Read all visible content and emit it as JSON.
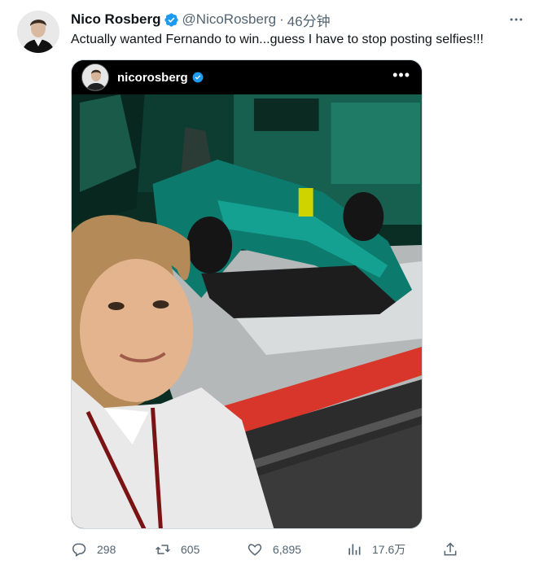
{
  "user": {
    "display_name": "Nico Rosberg",
    "handle": "@NicoRosberg",
    "separator": "·",
    "time": "46分钟"
  },
  "tweet": {
    "text": "Actually wanted Fernando to win...guess I have to stop posting selfies!!!"
  },
  "media": {
    "instagram_username": "nicorosberg",
    "more_glyph": "•••"
  },
  "actions": {
    "replies": "298",
    "retweets": "605",
    "likes": "6,895",
    "views": "17.6万"
  },
  "colors": {
    "text": "#0f1419",
    "secondary": "#536471",
    "verified": "#1d9bf0",
    "border": "#cfd9de",
    "car_teal": "#0d7a6e",
    "garage_green": "#0b3a2c",
    "pit_red": "#d8362b"
  },
  "icons": [
    "verified-badge-icon",
    "more-icon",
    "reply-icon",
    "retweet-icon",
    "like-icon",
    "views-icon",
    "share-icon"
  ]
}
